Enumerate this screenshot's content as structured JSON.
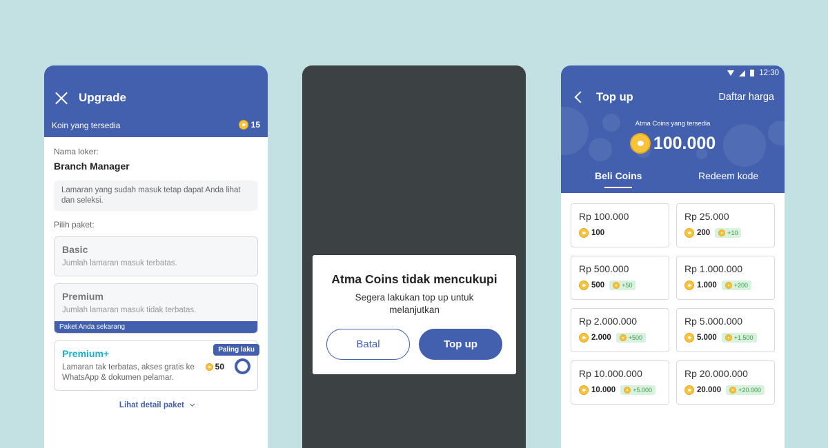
{
  "upgrade": {
    "title": "Upgrade",
    "coins_label": "Koin yang tersedia",
    "coins_value": "15",
    "job_label": "Nama loker:",
    "job_name": "Branch Manager",
    "note": "Lamaran yang sudah masuk tetap dapat Anda lihat dan seleksi.",
    "package_label": "Pilih paket:",
    "packages": [
      {
        "name": "Basic",
        "desc": "Jumlah lamaran masuk terbatas."
      },
      {
        "name": "Premium",
        "desc": "Jumlah lamaran masuk tidak terbatas.",
        "current_label": "Paket Anda sekarang"
      },
      {
        "name": "Premium+",
        "desc": "Lamaran tak terbatas, akses gratis ke WhatsApp & dokumen pelamar.",
        "price": "50",
        "badge": "Paling laku"
      }
    ],
    "detail_link": "Lihat detail paket"
  },
  "dialog": {
    "title": "Atma Coins tidak mencukupi",
    "message": "Segera lakukan top up untuk melanjutkan",
    "cancel_label": "Batal",
    "confirm_label": "Top up"
  },
  "topup": {
    "status_time": "12:30",
    "title": "Top up",
    "price_list": "Daftar harga",
    "available_label": "Atma Coins yang tersedia",
    "balance": "100.000",
    "tabs": [
      "Beli Coins",
      "Redeem kode"
    ],
    "options": [
      {
        "price": "Rp 100.000",
        "coins": "100",
        "bonus": ""
      },
      {
        "price": "Rp 25.000",
        "coins": "200",
        "bonus": "+10"
      },
      {
        "price": "Rp 500.000",
        "coins": "500",
        "bonus": "+50"
      },
      {
        "price": "Rp 1.000.000",
        "coins": "1.000",
        "bonus": "+200"
      },
      {
        "price": "Rp 2.000.000",
        "coins": "2.000",
        "bonus": "+500"
      },
      {
        "price": "Rp 5.000.000",
        "coins": "5.000",
        "bonus": "+1.500"
      },
      {
        "price": "Rp 10.000.000",
        "coins": "10.000",
        "bonus": "+5.000"
      },
      {
        "price": "Rp 20.000.000",
        "coins": "20.000",
        "bonus": "+20.000"
      }
    ]
  },
  "colors": {
    "primary": "#4260ad",
    "background": "#c3e0e3",
    "overlay": "#3c4244",
    "coin": "#f6c33a",
    "bonus_bg": "#d9f2dd",
    "premium_plus": "#1ab0c8"
  }
}
